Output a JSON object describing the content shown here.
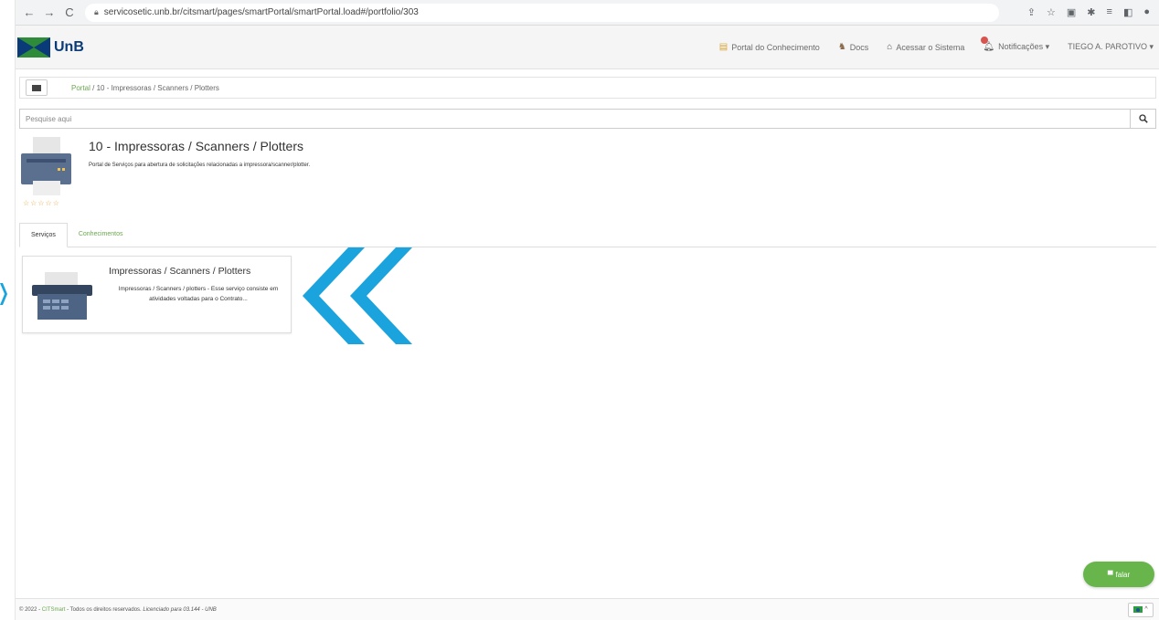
{
  "browser": {
    "url": "servicosetic.unb.br/citsmart/pages/smartPortal/smartPortal.load#/portfolio/303",
    "back_icon": "←",
    "forward_icon": "→",
    "reload_icon": "C"
  },
  "header": {
    "brand": "UnB",
    "nav": {
      "knowledge": "Portal do Conhecimento",
      "docs": "Docs",
      "access": "Acessar o Sistema",
      "notifications": "Notificações ▾",
      "user": "TIEGO A. PAROTIVO ▾"
    }
  },
  "breadcrumb": {
    "home": "Portal",
    "separator": " / ",
    "current": "10 - Impressoras / Scanners / Plotters"
  },
  "search": {
    "placeholder": "Pesquise aqui"
  },
  "portal": {
    "title": "10 - Impressoras / Scanners / Plotters",
    "description": "Portal de Serviços para abertura de solicitações relacionadas a impressora/scanner/plotter.",
    "rating_stars": "☆☆☆☆☆"
  },
  "tabs": [
    {
      "label": "Serviços",
      "active": true
    },
    {
      "label": "Conhecimentos",
      "active": false
    }
  ],
  "service_card": {
    "title": "Impressoras / Scanners / Plotters",
    "description": "Impressoras / Scanners / plotters - Esse serviço consiste em atividades voltadas para o Contrato..."
  },
  "chat_button": {
    "label": "falar"
  },
  "footer": {
    "prefix": "© 2022 - ",
    "brand": "CITSmart",
    "rights": " - Todos os direitos reservados. ",
    "license": "Licenciado para 03.144 - UNB"
  },
  "colors": {
    "accent_green": "#68b64b",
    "link_green": "#6aa84f",
    "chevron_blue": "#1aa3dd",
    "unb_navy": "#0a3b78"
  }
}
